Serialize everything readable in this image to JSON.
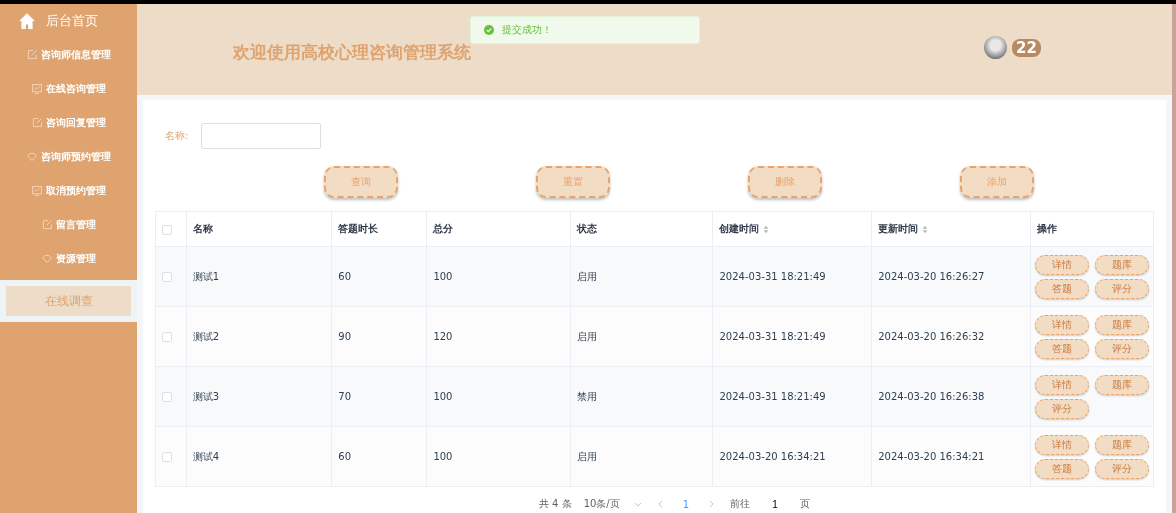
{
  "sidebar": {
    "home": {
      "label": "后台首页"
    },
    "items": [
      {
        "label": "咨询师信息管理",
        "selected": false
      },
      {
        "label": "在线咨询管理",
        "selected": false
      },
      {
        "label": "咨询回复管理",
        "selected": false
      },
      {
        "label": "咨询师预约管理",
        "selected": false
      },
      {
        "label": "取消预约管理",
        "selected": false
      },
      {
        "label": "留言管理",
        "selected": false
      },
      {
        "label": "资源管理",
        "selected": false
      },
      {
        "label": "在线调查",
        "selected": true
      }
    ]
  },
  "header": {
    "title": "欢迎使用高校心理咨询管理系统",
    "user": {
      "name": "22"
    }
  },
  "toast": {
    "message": "提交成功！"
  },
  "search": {
    "label": "名称:"
  },
  "actions": [
    "查询",
    "重置",
    "删除",
    "添加"
  ],
  "table": {
    "all_checked": false,
    "columns": [
      {
        "label": "名称",
        "sortable": false
      },
      {
        "label": "答题时长",
        "sortable": false
      },
      {
        "label": "总分",
        "sortable": false
      },
      {
        "label": "状态",
        "sortable": false
      },
      {
        "label": "创建时间",
        "sortable": true
      },
      {
        "label": "更新时间",
        "sortable": true
      },
      {
        "label": "操作",
        "sortable": false
      }
    ],
    "rows": [
      {
        "checked": false,
        "cells": [
          "测试1",
          "60",
          "100",
          "启用",
          "2024-03-31 18:21:49",
          "2024-03-20 16:26:27"
        ],
        "actions": [
          "详情",
          "题库",
          "答题",
          "评分"
        ]
      },
      {
        "checked": false,
        "cells": [
          "测试2",
          "90",
          "120",
          "启用",
          "2024-03-31 18:21:49",
          "2024-03-20 16:26:32"
        ],
        "actions": [
          "详情",
          "题库",
          "答题",
          "评分"
        ]
      },
      {
        "checked": false,
        "cells": [
          "测试3",
          "70",
          "100",
          "禁用",
          "2024-03-31 18:21:49",
          "2024-03-20 16:26:38"
        ],
        "actions": [
          "详情",
          "题库",
          "评分"
        ]
      },
      {
        "checked": false,
        "cells": [
          "测试4",
          "60",
          "100",
          "启用",
          "2024-03-20 16:34:21",
          "2024-03-20 16:34:21"
        ],
        "actions": [
          "详情",
          "题库",
          "答题",
          "评分"
        ]
      }
    ]
  },
  "pagination": {
    "total": "共 4 条",
    "page_size": "10条/页",
    "current": "1",
    "goto_label": "前往",
    "goto_value": "1",
    "goto_suffix": "页"
  }
}
